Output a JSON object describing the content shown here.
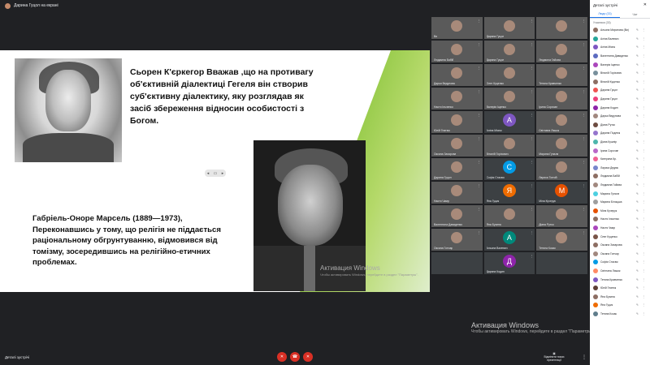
{
  "topbar": {
    "title": "Дарина Гуцол на екрані"
  },
  "slide": {
    "text1": "Сьорен К'єркегор Вважав ,що на противагу об'єктивній діалектиці Гегеля він створив суб'єктивну діалектику, яку розглядав як засіб збереження відносин особистості з Богом.",
    "text2": "Габріель-Оноре Марсель (1889—1973), Переконавшись у тому, що релігія не піддається раціональному обгрунтуванню, відмовився від томізму, зосередившись на релігійно-етичних проблемах.",
    "ctrl": [
      "◂",
      "▭",
      "▸"
    ],
    "watermark_title": "Активация Windows",
    "watermark_sub": "Чтобы активировать Windows, перейдите в раздел \"Параметры\"."
  },
  "tiles": [
    {
      "name": "Ви",
      "type": "cam"
    },
    {
      "name": "Дарина Гуцол",
      "type": "cam"
    },
    {
      "name": "",
      "type": "cam"
    },
    {
      "name": "Людмила Бабій",
      "type": "cam"
    },
    {
      "name": "Дарина Гуцол",
      "type": "cam"
    },
    {
      "name": "Людмила Гайова",
      "type": "cam"
    },
    {
      "name": "Дарья Ведунова",
      "type": "cam"
    },
    {
      "name": "Олег Куценко",
      "type": "cam"
    },
    {
      "name": "Тетяна Кравченко",
      "type": "cam"
    },
    {
      "name": "Настя Ільченко",
      "type": "cam"
    },
    {
      "name": "Валерія Іщенко",
      "type": "cam"
    },
    {
      "name": "Ірина Сорочан",
      "type": "cam"
    },
    {
      "name": "Юлій Гнатюк",
      "type": "cam"
    },
    {
      "name": "Аліна Місюк",
      "type": "avatar",
      "letter": "А",
      "color": "#7e57c2"
    },
    {
      "name": "Світлана Ляшок",
      "type": "cam"
    },
    {
      "name": "Оксана Захарова",
      "type": "cam"
    },
    {
      "name": "Віталій Горіхович",
      "type": "cam"
    },
    {
      "name": "Марина Гупала",
      "type": "cam"
    },
    {
      "name": "Дарина Гуцол",
      "type": "cam"
    },
    {
      "name": "Софія Стасюк",
      "type": "avatar",
      "letter": "С",
      "color": "#039be5"
    },
    {
      "name": "Лариса Топчій",
      "type": "cam"
    },
    {
      "name": "Настя Чмир",
      "type": "cam"
    },
    {
      "name": "Яна Гуцик",
      "type": "avatar",
      "letter": "Я",
      "color": "#ef6c00"
    },
    {
      "name": "Міла Кучерук",
      "type": "avatar",
      "letter": "М",
      "color": "#e65100"
    },
    {
      "name": "Валентина Давиденко",
      "type": "cam"
    },
    {
      "name": "Яна Бузина",
      "type": "cam"
    },
    {
      "name": "Діана Рутко",
      "type": "cam"
    },
    {
      "name": "Оксана Гончар",
      "type": "cam"
    },
    {
      "name": "Альона Валевич",
      "type": "avatar",
      "letter": "А",
      "color": "#00897b"
    },
    {
      "name": "Тетяна Козак",
      "type": "cam"
    },
    {
      "name": "",
      "type": "empty"
    },
    {
      "name": "Дарина Кодин",
      "type": "avatar",
      "letter": "Д",
      "color": "#8e24aa"
    },
    {
      "name": "",
      "type": "empty"
    }
  ],
  "windows_watermark": {
    "title": "Активация Windows",
    "sub": "Чтобы активировать Windows, перейдите в раздел \"Параметры\"."
  },
  "bottombar": {
    "meeting": "Деталі зустрічі",
    "present_label": "Відмінити показ презентації",
    "buttons": [
      "mic",
      "end",
      "cam"
    ]
  },
  "panel": {
    "title": "Деталі зустрічі",
    "tab_people": "Люди (33)",
    "tab_chat": "Чат",
    "add_people": "Учасники (33)",
    "participants": [
      "Альона Миронова (Ви)",
      "Аліна Валевич",
      "Аліна Місюк",
      "Валентина Давиденко",
      "Валерія Іщенко",
      "Віталій Горіхович",
      "Віталій Куценко",
      "Дарина Гуцол",
      "Дарина Гуцол",
      "Дарина Кодин",
      "Дарья Ведунова",
      "Діана Рутко",
      "Дарина Подлюк",
      "Діана Кушнір",
      "Ірина Сорочан",
      "Катерина Кр.",
      "Лариса Дедюк",
      "Людмила Бабій",
      "Людмила Гайова",
      "Марина Гупала",
      "Марина Білоцька",
      "Міла Кучерук",
      "Настя Ільченко",
      "Настя Чмир",
      "Олег Куценко",
      "Оксана Захарова",
      "Оксана Гончар",
      "Софія Стасюк",
      "Світлана Ляшок",
      "Тетяна Кравченко",
      "Юлій Гнатюк",
      "Яна Бузина",
      "Яна Гуцик",
      "Тетяна Козак"
    ]
  }
}
